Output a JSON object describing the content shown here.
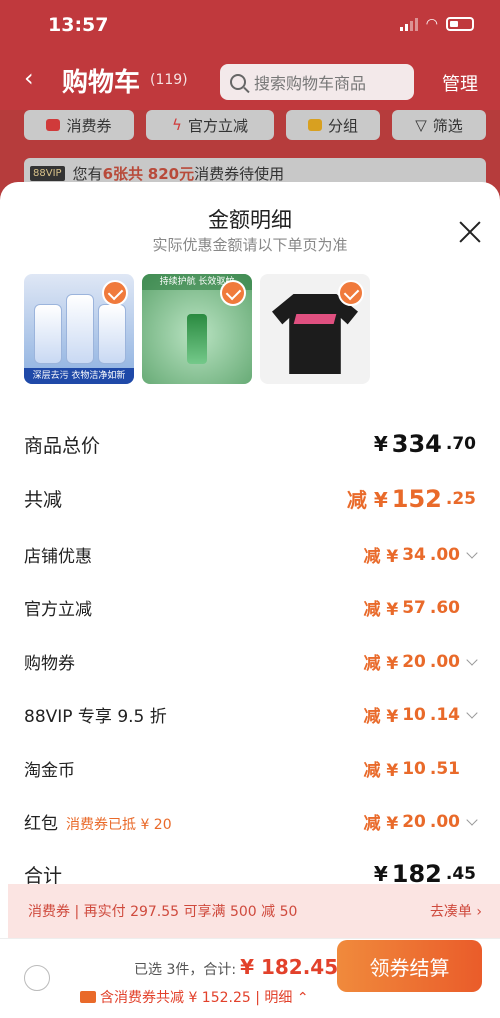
{
  "status": {
    "time": "13:57"
  },
  "header": {
    "back": "‹",
    "title": "购物车",
    "count": "(119)",
    "search_placeholder": "搜索购物车商品",
    "manage": "管理"
  },
  "filters": [
    {
      "label": "消费券",
      "color": "#d03a3a"
    },
    {
      "label": "官方立减",
      "color": "#d03a3a"
    },
    {
      "label": "分组",
      "color": "#d8a020"
    },
    {
      "label": "筛选",
      "color": "#333333"
    }
  ],
  "coupon_bar": {
    "badge": "88VIP",
    "pre": "您有",
    "count": "6张共",
    "amount": "820元",
    "post": "消费券待使用"
  },
  "sheet": {
    "title": "金额明细",
    "subtitle": "实际优惠金额请以下单页为准",
    "thumbs": [
      {
        "caption": "深层去污 衣物洁净如新"
      },
      {
        "caption": "持续护航 长效驱蚊"
      },
      {
        "caption": ""
      }
    ],
    "rows": [
      {
        "label": "商品总价",
        "prefix": "¥",
        "int": "334",
        "dec": ".70",
        "style": "total"
      },
      {
        "label": "共减",
        "prefix": "减 ¥",
        "int": "152",
        "dec": ".25",
        "style": "reduce-total"
      },
      {
        "label": "店铺优惠",
        "prefix": "减 ¥",
        "int": "34",
        "dec": ".00",
        "chev": true
      },
      {
        "label": "官方立减",
        "prefix": "减 ¥",
        "int": "57",
        "dec": ".60",
        "chev": false
      },
      {
        "label": "购物券",
        "prefix": "减 ¥",
        "int": "20",
        "dec": ".00",
        "chev": true
      },
      {
        "label": "88VIP 专享 9.5 折",
        "prefix": "减 ¥",
        "int": "10",
        "dec": ".14",
        "chev": true
      },
      {
        "label": "淘金币",
        "prefix": "减 ¥",
        "int": "10",
        "dec": ".51",
        "chev": false
      },
      {
        "label": "红包",
        "sublabel": "消费券已抵 ¥ 20",
        "prefix": "减 ¥",
        "int": "20",
        "dec": ".00",
        "chev": true
      },
      {
        "label": "合计",
        "prefix": "¥",
        "int": "182",
        "dec": ".45",
        "style": "total"
      }
    ]
  },
  "promo": {
    "left": "消费券 | 再实付 297.55 可享满 500 减 50",
    "right": "去凑单 ›"
  },
  "footer": {
    "selected": "已选 3件，合计:",
    "amount": "¥ 182.45",
    "coupon_text": "含消费券共减 ¥ 152.25 | 明细 ⌃",
    "button": "领券结算"
  }
}
